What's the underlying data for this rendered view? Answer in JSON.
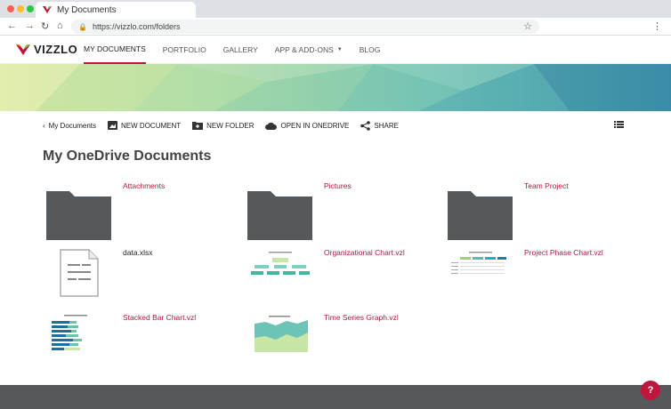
{
  "browser": {
    "tab_title": "My Documents",
    "url": "https://vizzlo.com/folders"
  },
  "site": {
    "brand": "VIZZLO",
    "brand_colors": {
      "primary": "#c0163c",
      "logo_green": "#8cc63f",
      "logo_orange": "#f7931e"
    },
    "nav": [
      {
        "label": "MY DOCUMENTS",
        "active": true
      },
      {
        "label": "PORTFOLIO",
        "active": false
      },
      {
        "label": "GALLERY",
        "active": false
      },
      {
        "label": "APP & ADD-ONS",
        "active": false
      },
      {
        "label": "BLOG",
        "active": false
      }
    ]
  },
  "toolbar": {
    "back": "My Documents",
    "new_document": "NEW DOCUMENT",
    "new_folder": "NEW FOLDER",
    "open_onedrive": "OPEN IN ONEDRIVE",
    "share": "SHARE"
  },
  "page": {
    "title": "My OneDrive Documents"
  },
  "items": [
    {
      "name": "Attachments",
      "kind": "folder"
    },
    {
      "name": "Pictures",
      "kind": "folder"
    },
    {
      "name": "Team Project",
      "kind": "folder"
    },
    {
      "name": "data.xlsx",
      "kind": "spreadsheet"
    },
    {
      "name": "Organizational Chart.vzl",
      "kind": "chart"
    },
    {
      "name": "Project Phase Chart.vzl",
      "kind": "chart"
    },
    {
      "name": "Stacked Bar Chart.vzl",
      "kind": "chart"
    },
    {
      "name": "Time Series Graph.vzl",
      "kind": "chart"
    }
  ],
  "help": {
    "label": "?"
  }
}
